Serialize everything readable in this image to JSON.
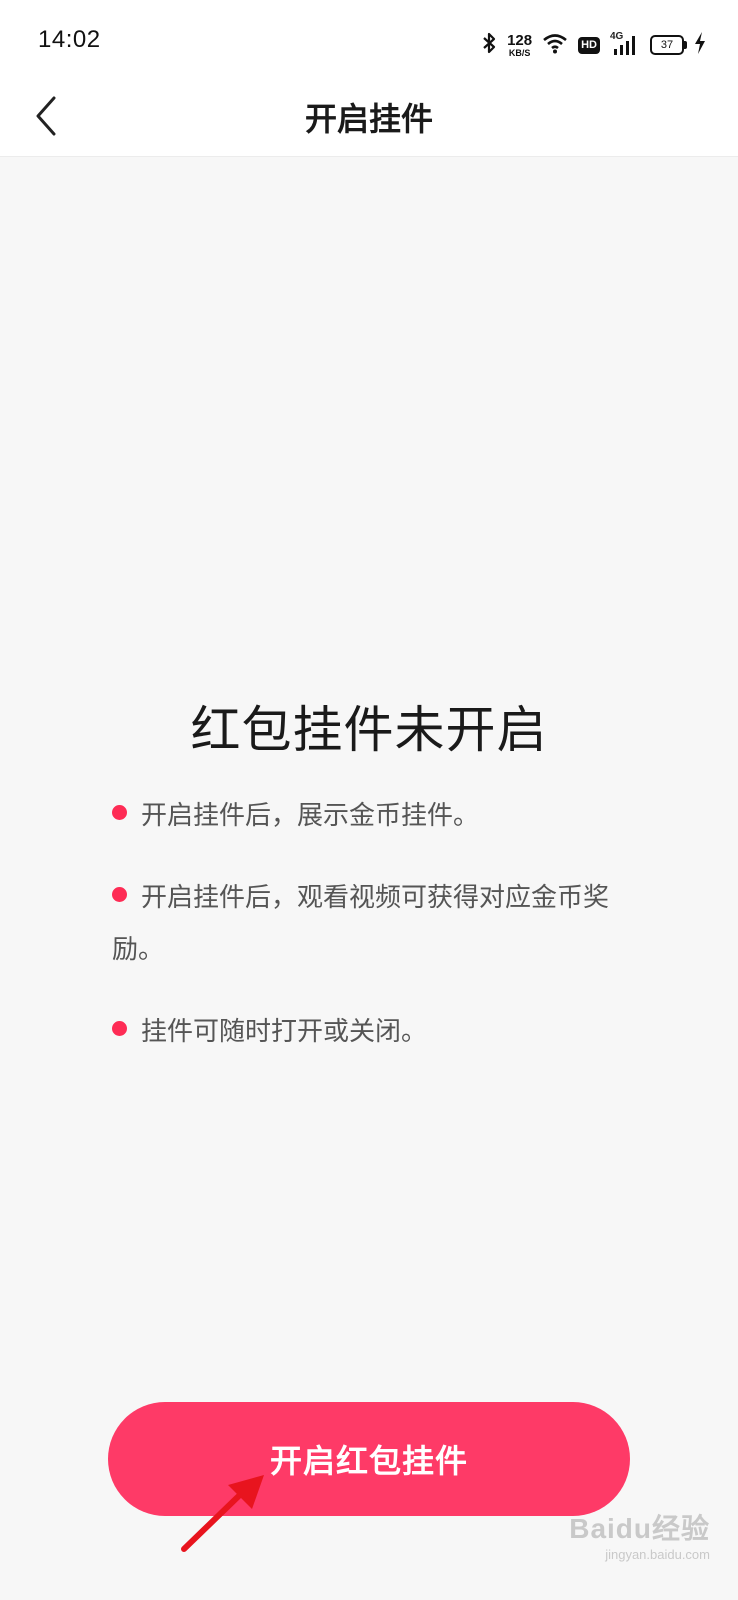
{
  "status_bar": {
    "time": "14:02",
    "net_speed_value": "128",
    "net_speed_unit": "KB/S",
    "hd_label": "HD",
    "signal_label": "4G",
    "battery_level": "37",
    "icons": [
      "bluetooth-icon",
      "wifi-icon",
      "signal-icon",
      "charging-icon"
    ]
  },
  "header": {
    "title": "开启挂件",
    "back_icon": "chevron-left-icon"
  },
  "main": {
    "title": "红包挂件未开启",
    "bullets": [
      "开启挂件后，展示金币挂件。",
      "开启挂件后，观看视频可获得对应金币奖励。",
      "挂件可随时打开或关闭。"
    ]
  },
  "button": {
    "label": "开启红包挂件"
  },
  "watermark": {
    "logo": "Baidu经验",
    "url": "jingyan.baidu.com"
  },
  "colors": {
    "accent": "#fe2c55",
    "button": "#fe3a67",
    "background": "#f7f7f7",
    "annotation_arrow": "#e8141e"
  }
}
